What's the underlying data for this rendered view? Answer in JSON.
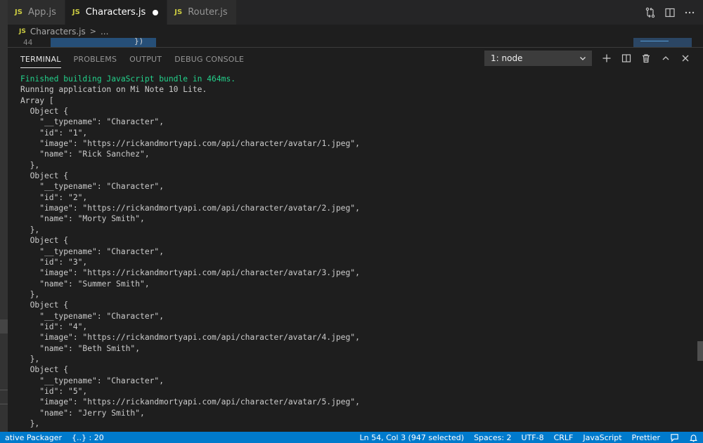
{
  "tabs": [
    {
      "icon_text": "JS",
      "label": "App.js"
    },
    {
      "icon_text": "JS",
      "label": "Characters.js",
      "modified": true
    },
    {
      "icon_text": "JS",
      "label": "Router.js"
    }
  ],
  "breadcrumb": {
    "icon_text": "JS",
    "file": "Characters.js",
    "separator": ">",
    "rest": "..."
  },
  "editor_peek": {
    "line_number": "44",
    "code": "                })"
  },
  "panel": {
    "tabs": [
      "TERMINAL",
      "PROBLEMS",
      "OUTPUT",
      "DEBUG CONSOLE"
    ],
    "terminal_selected": "1: node"
  },
  "terminal_lines": [
    {
      "text": "Finished building JavaScript bundle in 464ms.",
      "color": "#23d18b"
    },
    {
      "text": "Running application on Mi Note 10 Lite."
    },
    {
      "text": "Array ["
    },
    {
      "text": "  Object {"
    },
    {
      "text": "    \"__typename\": \"Character\","
    },
    {
      "text": "    \"id\": \"1\","
    },
    {
      "text": "    \"image\": \"https://rickandmortyapi.com/api/character/avatar/1.jpeg\","
    },
    {
      "text": "    \"name\": \"Rick Sanchez\","
    },
    {
      "text": "  },"
    },
    {
      "text": "  Object {"
    },
    {
      "text": "    \"__typename\": \"Character\","
    },
    {
      "text": "    \"id\": \"2\","
    },
    {
      "text": "    \"image\": \"https://rickandmortyapi.com/api/character/avatar/2.jpeg\","
    },
    {
      "text": "    \"name\": \"Morty Smith\","
    },
    {
      "text": "  },"
    },
    {
      "text": "  Object {"
    },
    {
      "text": "    \"__typename\": \"Character\","
    },
    {
      "text": "    \"id\": \"3\","
    },
    {
      "text": "    \"image\": \"https://rickandmortyapi.com/api/character/avatar/3.jpeg\","
    },
    {
      "text": "    \"name\": \"Summer Smith\","
    },
    {
      "text": "  },"
    },
    {
      "text": "  Object {"
    },
    {
      "text": "    \"__typename\": \"Character\","
    },
    {
      "text": "    \"id\": \"4\","
    },
    {
      "text": "    \"image\": \"https://rickandmortyapi.com/api/character/avatar/4.jpeg\","
    },
    {
      "text": "    \"name\": \"Beth Smith\","
    },
    {
      "text": "  },"
    },
    {
      "text": "  Object {"
    },
    {
      "text": "    \"__typename\": \"Character\","
    },
    {
      "text": "    \"id\": \"5\","
    },
    {
      "text": "    \"image\": \"https://rickandmortyapi.com/api/character/avatar/5.jpeg\","
    },
    {
      "text": "    \"name\": \"Jerry Smith\","
    },
    {
      "text": "  },"
    }
  ],
  "statusbar": {
    "left": [
      "ative Packager",
      "{..} : 20"
    ],
    "right": [
      "Ln 54, Col 3 (947 selected)",
      "Spaces: 2",
      "UTF-8",
      "CRLF",
      "JavaScript",
      "Prettier"
    ]
  },
  "icons": {
    "tab_actions": [
      "compare-changes-icon",
      "split-editor-icon",
      "more-actions-icon"
    ],
    "panel_actions": [
      "add-terminal-icon",
      "split-terminal-icon",
      "trash-icon",
      "maximize-panel-icon",
      "close-panel-icon"
    ],
    "status_right": [
      "feedback-icon",
      "bell-icon"
    ]
  },
  "colors": {
    "statusbar": "#007acc",
    "terminal_green": "#23d18b",
    "js_icon": "#cbcb41"
  }
}
